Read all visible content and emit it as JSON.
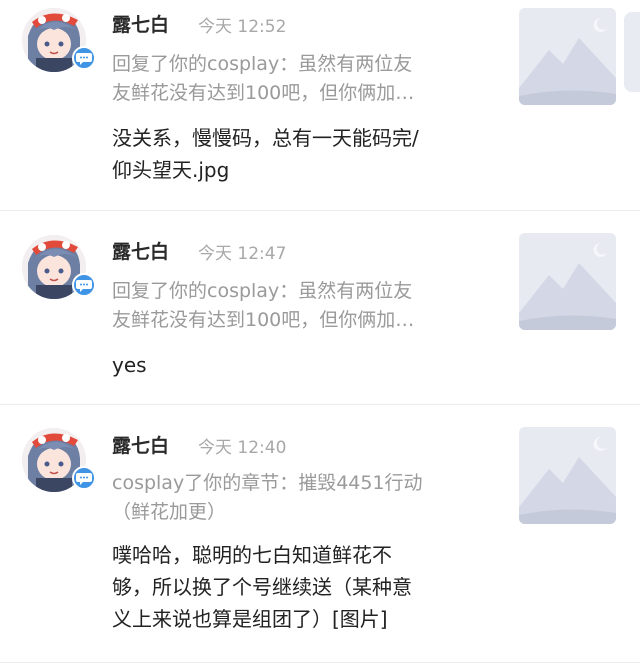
{
  "accent_color": "#3f94e6",
  "notifications": [
    {
      "name": "露七白",
      "time": "今天 12:52",
      "quote": "回复了你的cosplay：虽然有两位友\n友鲜花没有达到100吧，但你俩加…",
      "message": "没关系，慢慢码，总有一天能码完/\n仰头望天.jpg",
      "avatar_icon": "anime-avatar-icon",
      "badge_icon": "chat-bubble-icon",
      "thumb_icon": "landscape-placeholder-icon"
    },
    {
      "name": "露七白",
      "time": "今天 12:47",
      "quote": "回复了你的cosplay：虽然有两位友\n友鲜花没有达到100吧，但你俩加…",
      "message": "yes",
      "avatar_icon": "anime-avatar-icon",
      "badge_icon": "chat-bubble-icon",
      "thumb_icon": "landscape-placeholder-icon"
    },
    {
      "name": "露七白",
      "time": "今天 12:40",
      "quote": "cosplay了你的章节：摧毁4451行动\n（鲜花加更）",
      "message": "噗哈哈，聪明的七白知道鲜花不\n够，所以换了个号继续送（某种意\n义上来说也算是组团了）[图片]",
      "avatar_icon": "anime-avatar-icon",
      "badge_icon": "chat-bubble-icon",
      "thumb_icon": "landscape-placeholder-icon"
    }
  ]
}
